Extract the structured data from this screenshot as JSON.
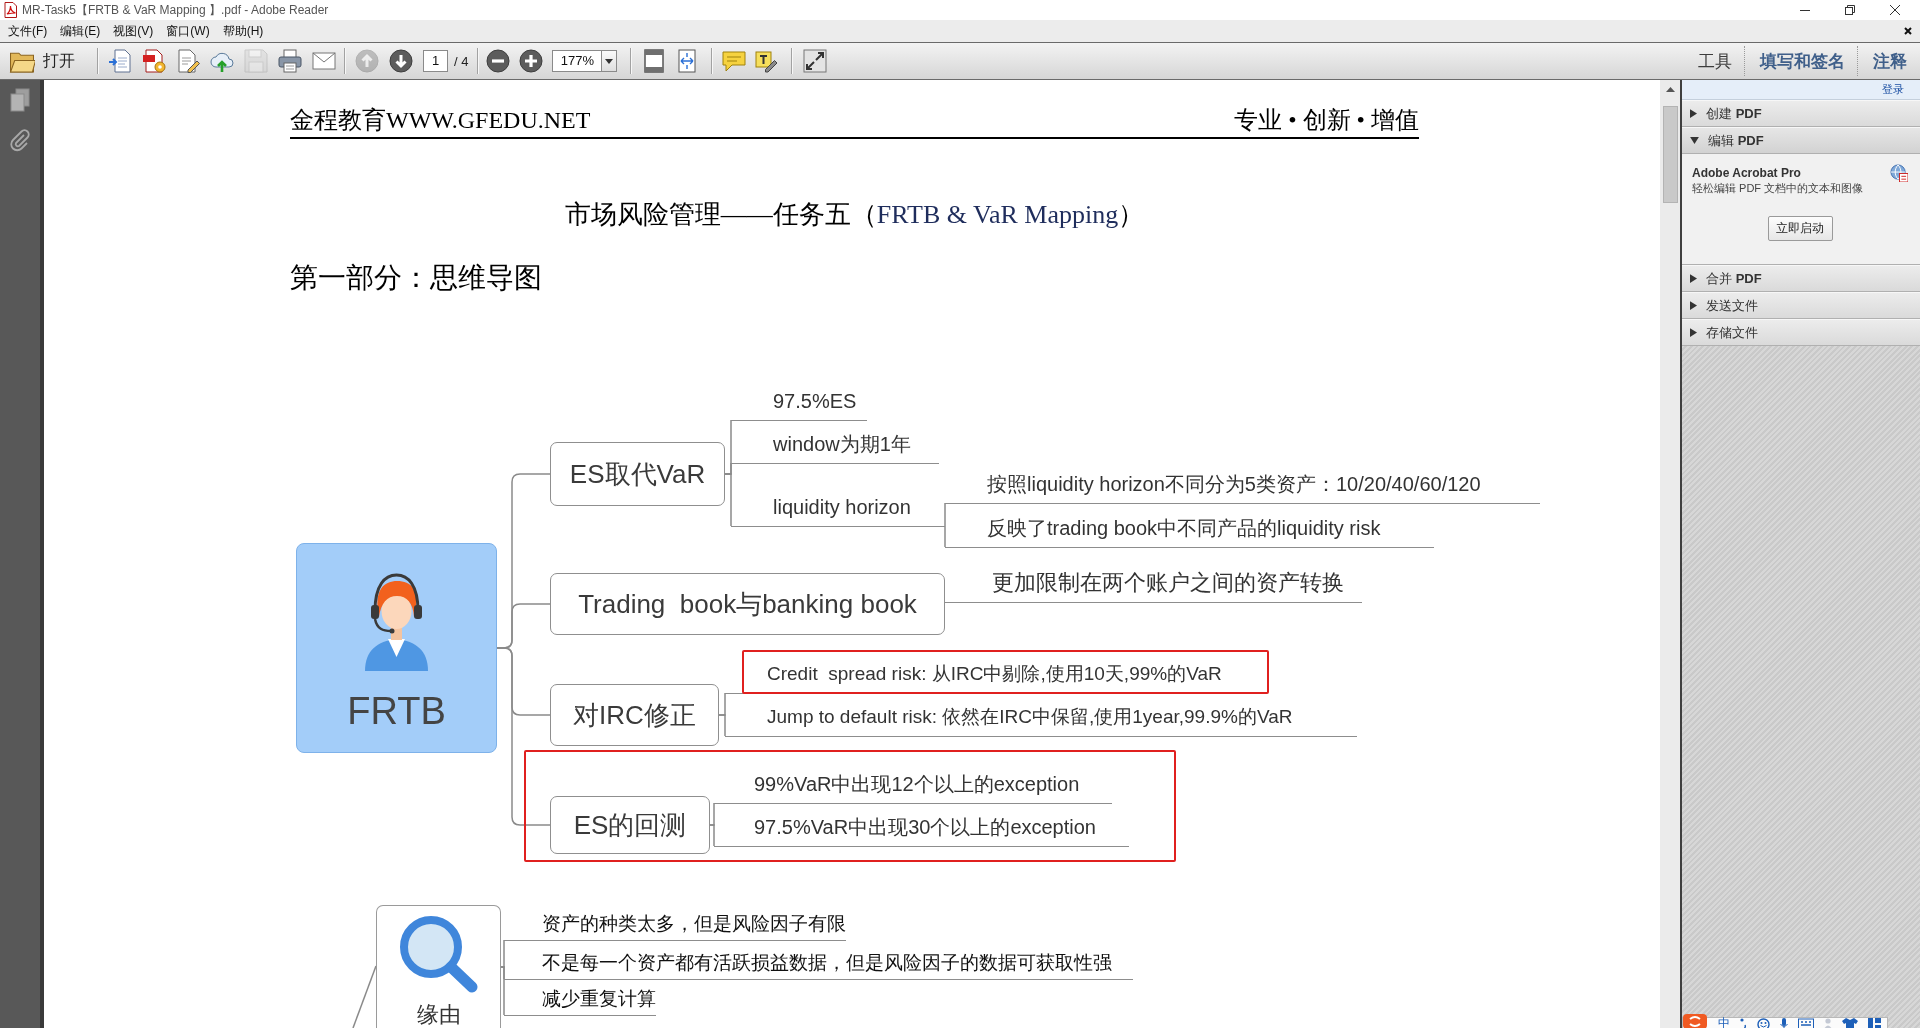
{
  "window": {
    "title": "MR-Task5【FRTB & VaR Mapping 】.pdf - Adobe Reader"
  },
  "menu_bar": {
    "items": [
      "文件(F)",
      "编辑(E)",
      "视图(V)",
      "窗口(W)",
      "帮助(H)"
    ]
  },
  "toolbar": {
    "open_label": "打开",
    "file_buttons": [
      {
        "disabled": false
      },
      {
        "disabled": false
      },
      {
        "disabled": false
      },
      {
        "disabled": false
      },
      {
        "disabled": true
      },
      {
        "disabled": false
      },
      {
        "disabled": false
      }
    ],
    "page_nav": {
      "previous_disabled": true,
      "next_disabled": false,
      "current_page": "1",
      "page_count": "/ 4"
    },
    "zoom_value": "177%",
    "pane_buttons": [
      {
        "label": "工具",
        "kind": "plain"
      },
      {
        "label": "填写和签名",
        "kind": "accent"
      },
      {
        "label": "注释",
        "kind": "accent"
      }
    ]
  },
  "document": {
    "header_left": "金程教育WWW.GFEDU.NET",
    "header_right": "专业 • 创新 • 增值",
    "title_runs": [
      {
        "text": "市场风险管理——任务五（",
        "color": "#000000"
      },
      {
        "text": "FRTB & VaR Mapping",
        "color": "#1f2d5c"
      },
      {
        "text": "）",
        "color": "#000000"
      }
    ],
    "section_heading": "第一部分：思维导图",
    "mind_maps": [
      {
        "root": {
          "label": "FRTB",
          "highlighted": false,
          "children": [
            {
              "label": "ES取代VaR",
              "highlighted": false,
              "children": [
                {
                  "label": "97.5%ES",
                  "highlighted": false
                },
                {
                  "label": "window为期1年",
                  "highlighted": false
                },
                {
                  "label": "liquidity horizon",
                  "highlighted": false,
                  "children": [
                    {
                      "label": "按照liquidity horizon不同分为5类资产：10/20/40/60/120",
                      "highlighted": false
                    },
                    {
                      "label": "反映了trading book中不同产品的liquidity risk",
                      "highlighted": false
                    }
                  ]
                }
              ]
            },
            {
              "label": "Trading  book与banking book",
              "highlighted": false,
              "children": [
                {
                  "label": "更加限制在两个账户之间的资产转换",
                  "highlighted": false
                }
              ]
            },
            {
              "label": "对IRC修正",
              "highlighted": false,
              "children": [
                {
                  "label": "Credit  spread risk: 从IRC中剔除,使用10天,99%的VaR",
                  "highlighted": true
                },
                {
                  "label": "Jump to default risk: 依然在IRC中保留,使用1year,99.9%的VaR",
                  "highlighted": false
                }
              ]
            },
            {
              "label": "ES的回测",
              "highlighted": true,
              "children": [
                {
                  "label": "99%VaR中出现12个以上的exception",
                  "highlighted": false
                },
                {
                  "label": "97.5%VaR中出现30个以上的exception",
                  "highlighted": false
                }
              ]
            }
          ]
        }
      },
      {
        "root": {
          "label": "缘由",
          "highlighted": false,
          "children": [
            {
              "label": "资产的种类太多，但是风险因子有限",
              "highlighted": false
            },
            {
              "label": "不是每一个资产都有活跃损益数据，但是风险因子的数据可获取性强",
              "highlighted": false
            },
            {
              "label": "减少重复计算",
              "highlighted": false
            }
          ]
        }
      }
    ]
  },
  "right_panel": {
    "sign_in_link": "登录",
    "sections": [
      {
        "title": "创建 **PDF**",
        "expanded": false
      },
      {
        "title": "编辑 **PDF**",
        "expanded": true,
        "body": {
          "product": "Adobe Acrobat Pro",
          "description": "轻松编辑 PDF 文档中的文本和图像",
          "button": "立即启动"
        }
      },
      {
        "title": "合并 **PDF**",
        "expanded": false
      },
      {
        "title": "发送文件",
        "expanded": false
      },
      {
        "title": "存储文件",
        "expanded": false
      }
    ]
  },
  "ime_toolbar": {
    "mode": "中"
  }
}
